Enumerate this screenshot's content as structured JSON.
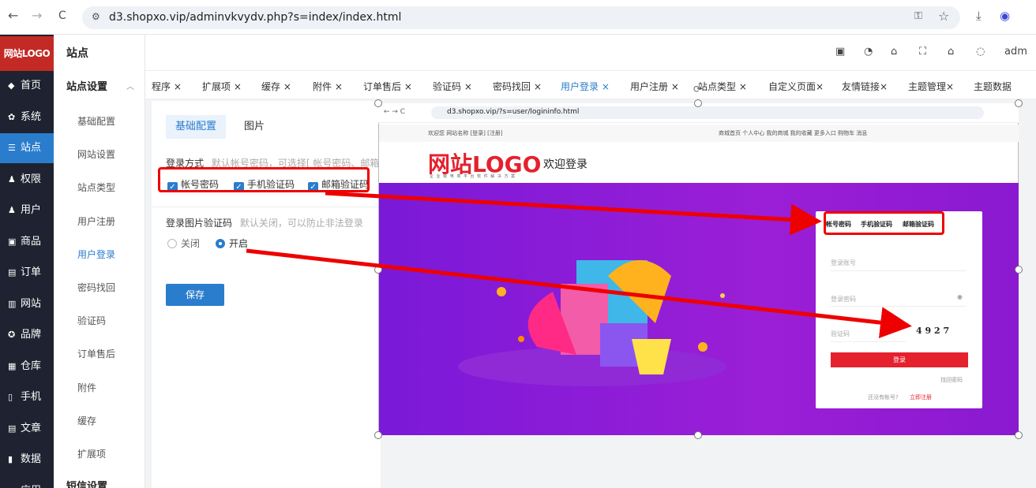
{
  "browser": {
    "url": "d3.shopxo.vip/adminvkvydv.php?s=index/index.html",
    "back": "←",
    "forward": "→",
    "reload": "C"
  },
  "sidebar": {
    "logo": "网站LOGO",
    "items": [
      {
        "label": "首页",
        "icon": "home-icon"
      },
      {
        "label": "系统",
        "icon": "gear-icon"
      },
      {
        "label": "站点",
        "icon": "sliders-icon"
      },
      {
        "label": "权限",
        "icon": "user-lock-icon"
      },
      {
        "label": "用户",
        "icon": "user-icon"
      },
      {
        "label": "商品",
        "icon": "goods-icon"
      },
      {
        "label": "订单",
        "icon": "order-icon"
      },
      {
        "label": "网站",
        "icon": "web-icon"
      },
      {
        "label": "品牌",
        "icon": "brand-icon"
      },
      {
        "label": "仓库",
        "icon": "warehouse-icon"
      },
      {
        "label": "手机",
        "icon": "phone-icon"
      },
      {
        "label": "文章",
        "icon": "article-icon"
      },
      {
        "label": "数据",
        "icon": "chart-icon"
      },
      {
        "label": "应用",
        "icon": "apps-icon"
      }
    ]
  },
  "sub_sidebar": {
    "header": "站点",
    "group": "站点设置",
    "items": [
      "基础配置",
      "网站设置",
      "站点类型",
      "用户注册",
      "用户登录",
      "密码找回",
      "验证码",
      "订单售后",
      "附件",
      "缓存",
      "扩展项"
    ],
    "group2": "短信设置"
  },
  "header": {
    "user": "adm"
  },
  "tabs": [
    "程序 ×",
    "扩展项 ×",
    "缓存 ×",
    "附件 ×",
    "订单售后 ×",
    "验证码 ×",
    "密码找回 ×",
    "用户登录 ×",
    "用户注册 ×",
    "站点类型 ×",
    "自定义页面×",
    "友情链接×",
    "主题管理×",
    "主题数据"
  ],
  "card": {
    "tab_basic": "基础配置",
    "tab_image": "图片",
    "login_method_label": "登录方式",
    "login_method_hint": "默认帐号密码，可选择[ 帐号密码、邮箱验证",
    "options": [
      "帐号密码",
      "手机验证码",
      "邮箱验证码"
    ],
    "captcha_label": "登录图片验证码",
    "captcha_hint": "默认关闭，可以防止非法登录",
    "radio_off": "关闭",
    "radio_on": "开启",
    "save": "保存"
  },
  "overlay": {
    "url": "d3.shopxo.vip/?s=user/logininfo.html",
    "top_left": "欢迎您 网站名称 [登录] [注册]",
    "top_right": "商城首页  个人中心  我的商城  我的收藏  更多入口  购物车  消息",
    "logo": "网站LOGO",
    "logo_sub": "企 业 级 电 商 平 台 软 件 解 决 方 案",
    "welcome": "欢迎登录",
    "login_tabs": [
      "帐号密码",
      "手机验证码",
      "邮箱验证码"
    ],
    "account_placeholder": "登录账号",
    "password_placeholder": "登录密码",
    "captcha_placeholder": "验证码",
    "captcha_code": "4 9 2 7",
    "login_button": "登录",
    "forgot": "找回密码",
    "register_prompt": "还没有帐号?",
    "register_link": "立即注册"
  },
  "colors": {
    "accent": "#2a7dcc",
    "sidebar_bg": "#1f2230",
    "brand_red": "#e4212d",
    "annotation_red": "#ee0000"
  }
}
